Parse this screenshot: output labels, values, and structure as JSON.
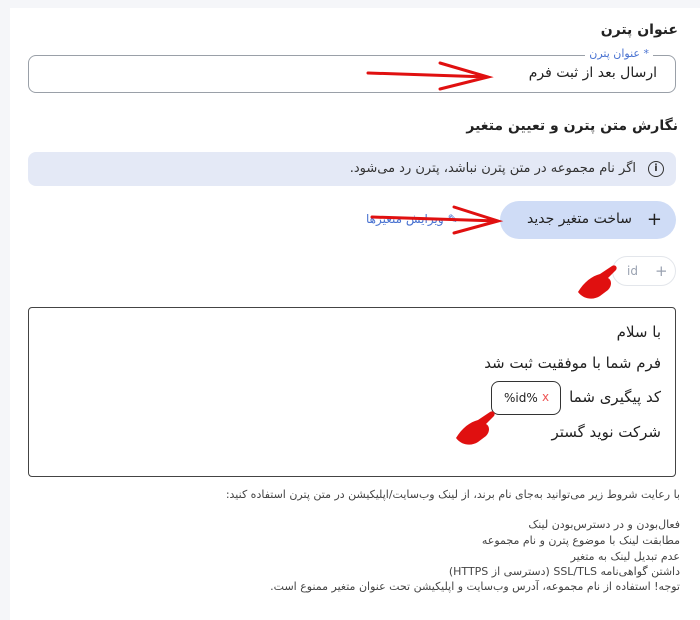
{
  "form": {
    "pattern_title_heading": "عنوان پترن",
    "pattern_title_field": {
      "legend": "عنوان پترن *",
      "value": "ارسال بعد از ثبت فرم"
    },
    "pattern_text_heading": "نگارش متن پترن و تعیین متغیر",
    "alert": {
      "icon": "info-icon",
      "text": "اگر نام مجموعه در متن پترن نباشد، پترن رد می‌شود."
    },
    "create_variable_button": {
      "icon": "plus-icon",
      "label": "ساخت متغیر جدید"
    },
    "edit_variables_link": {
      "icon": "pencil-icon",
      "label": "ویرایش متغیرها"
    },
    "variable_chip": {
      "icon": "plus-icon",
      "name": "id"
    },
    "editor": {
      "lines": [
        "با سلام",
        "فرم شما با موفقیت ثبت شد",
        "کد پیگیری شما",
        "شرکت نوید گستر"
      ],
      "token": {
        "value": "%id%",
        "remove": "x"
      }
    },
    "hints": [
      "با رعایت شروط زیر می‌توانید به‌جای نام برند، از لینک وب‌سایت/اپلیکیشن در متن پترن استفاده کنید:",
      "فعال‌بودن و در دسترس‌بودن لینک",
      "مطابقت لینک با موضوع پترن و نام مجموعه",
      "عدم تبدیل لینک به متغیر",
      "داشتن گواهی‌نامه SSL/TLS (دسترسی از HTTPS)",
      "توجه! استفاده از نام مجموعه، آدرس وب‌سایت و اپلیکیشن تحت عنوان متغیر ممنوع است."
    ]
  },
  "colors": {
    "accent": "#4a73d1",
    "alert_bg": "#e4e9f6",
    "button_bg": "#cfdcf6",
    "annotation_red": "#e01010"
  }
}
